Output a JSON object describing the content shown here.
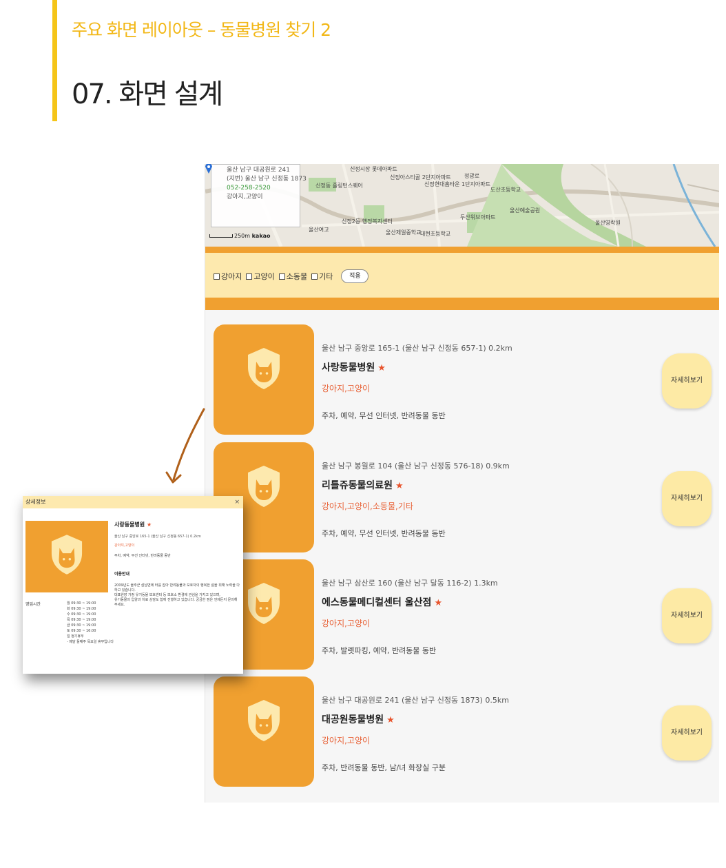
{
  "slide": {
    "subtitle": "주요 화면 레이아웃 – 동물병원 찾기 2",
    "title": "07. 화면 설계",
    "accent_color": "#f5c518"
  },
  "map": {
    "infobox": {
      "road_address": "울산 남구 대공원로 241",
      "jibun_address": "(지번) 울산 남구 신정동 1873",
      "phone": "052-258-2520",
      "animals": "강아지,고양이"
    },
    "scale_label": "250m",
    "provider": "kakao",
    "labels": [
      "신정동 홀링턴스퀘어",
      "신정시장 롯데아파트",
      "신정아스티골 2단지아파트",
      "신정현대홈타운 1단지아파트",
      "정광로",
      "도산초등학교",
      "울산여고",
      "신정2동 행정복지센터",
      "울산제일중학교",
      "대현초등학교",
      "두산위브아파트",
      "울산예술공원",
      "울산영락원"
    ],
    "pin_icon": "map-pin-icon"
  },
  "filter": {
    "options": [
      "강아지",
      "고양이",
      "소동물",
      "기타"
    ],
    "apply_label": "적용",
    "band_color": "#fde9ae",
    "stripe_color": "#f0a030"
  },
  "results": [
    {
      "address": "울산 남구 중앙로 165-1 (울산 남구 신정동 657-1)  0.2km",
      "name": "사랑동물병원",
      "star": "★",
      "animals": "강아지,고양이",
      "features": "주차, 예약, 무선 인터넷, 반려동물 동반",
      "detail_label": "자세히보기"
    },
    {
      "address": "울산 남구 봉월로 104 (울산 남구 신정동 576-18)  0.9km",
      "name": "리틀쥬동물의료원",
      "star": "★",
      "animals": "강아지,고양이,소동물,기타",
      "features": "주차, 예약, 무선 인터넷, 반려동물 동반",
      "detail_label": "자세히보기"
    },
    {
      "address": "울산 남구 삼산로 160 (울산 남구 달동 116-2)  1.3km",
      "name": "에스동물메디컬센터 울산점",
      "star": "★",
      "animals": "강아지,고양이",
      "features": "주차, 발렛파킹, 예약, 반려동물 동반",
      "detail_label": "자세히보기"
    },
    {
      "address": "울산 남구 대공원로 241 (울산 남구 신정동 1873)  0.5km",
      "name": "대공원동물병원",
      "star": "★",
      "animals": "강아지,고양이",
      "features": "주차, 반려동물 동반, 남/녀 화장실 구분",
      "detail_label": "자세히보기"
    }
  ],
  "popup": {
    "title": "상세정보",
    "close": "×",
    "name": "사랑동물병원",
    "star": "★",
    "address": "울산 남구 중앙로 165-1 (울산 남구 신정동 657-1)  0.2km",
    "animals": "강아지,고양이",
    "features": "주차, 예약, 무선 인터넷, 반려동물 동반",
    "hours_label": "영업시간",
    "hours": [
      "월 09:30 ~ 19:00",
      "화 09:30 ~ 19:00",
      "수 09:30 ~ 19:00",
      "목 09:30 ~ 19:00",
      "금 09:30 ~ 19:00",
      "토 09:30 ~ 16:00",
      "일 정기휴무",
      "- 매달 둘째주 목요일 휴무입니다"
    ],
    "notice_title": "이용안내",
    "notice_lines": [
      "2009년도 울주군 삼남면에 터를 잡아 반려동물과 보호자의 행복한 삶을 위해 노력을 다하고 있습니다.",
      "대표원장 가정 유기동물 보호센터 등 보호소 환경에 관심을 가지고 있으며,",
      "유기동물의 입양과 치료 상담도 함께 진행하고 있습니다. 궁금한 점은 언제든지 문의해 주세요."
    ]
  },
  "colors": {
    "orange": "#f0a030",
    "cream": "#fdeaa5",
    "tag": "#e8643a",
    "star": "#e8552e"
  },
  "icons": {
    "thumb": "cat-shield-icon",
    "arrow": "curved-arrow-icon"
  }
}
